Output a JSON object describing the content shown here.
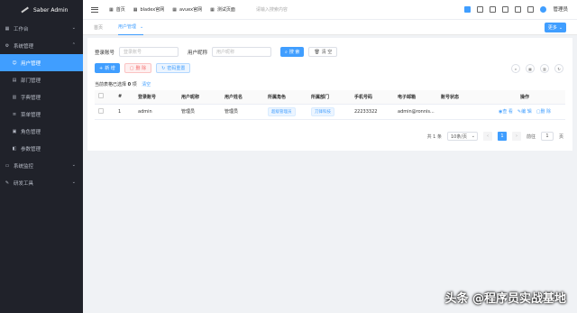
{
  "app_title": "Saber Admin",
  "sidebar": {
    "items": [
      {
        "label": "工作台",
        "icon": "dashboard-icon",
        "expanded": false
      },
      {
        "label": "系统管理",
        "icon": "settings-icon",
        "expanded": true,
        "children": [
          "用户管理",
          "部门管理",
          "字典管理",
          "菜单管理",
          "角色管理",
          "参数管理"
        ]
      },
      {
        "label": "系统监控",
        "icon": "monitor-icon",
        "expanded": false
      },
      {
        "label": "研发工具",
        "icon": "tools-icon",
        "expanded": false
      }
    ],
    "active_child": "用户管理"
  },
  "topbar": {
    "links": [
      "首页",
      "bladex官网",
      "avuex官网",
      "测试页面"
    ],
    "search_placeholder": "请输入搜索内容",
    "user_name": "管理员"
  },
  "tabs": [
    {
      "label": "首页",
      "active": false
    },
    {
      "label": "用户管理",
      "active": true
    }
  ],
  "more_button": "更多",
  "search_form": {
    "account_label": "登录账号",
    "account_placeholder": "登录账号",
    "nickname_label": "用户昵称",
    "nickname_placeholder": "用户昵称",
    "search_button": "搜 索",
    "clear_button": "清 空"
  },
  "actions": {
    "add": "新 增",
    "delete": "删 除",
    "reset_password": "密码重置"
  },
  "selection": {
    "prefix": "当前表格已选择",
    "count": "0",
    "suffix": "项",
    "clear": "清空"
  },
  "table": {
    "headers": [
      "",
      "#",
      "登录账号",
      "用户昵称",
      "用户姓名",
      "所属角色",
      "所属部门",
      "手机号码",
      "电子邮箱",
      "账号状态",
      "操作"
    ],
    "rows": [
      {
        "index": "1",
        "account": "admin",
        "nickname": "管理员",
        "realname": "管理员",
        "role": "超级管理员",
        "dept": "刀锋科技",
        "phone": "22233322",
        "email": "admin@ronnis...",
        "status": "",
        "op_view": "查 看",
        "op_edit": "编 辑",
        "op_delete": "删 除"
      }
    ]
  },
  "pagination": {
    "total": "共 1 条",
    "page_size": "10条/页",
    "current": "1",
    "goto_label": "前往",
    "goto_value": "1",
    "page_unit": "页"
  },
  "watermark": "头条 @程序员实战基地",
  "colors": {
    "primary": "#409eff",
    "sidebar_bg": "#20222a"
  }
}
